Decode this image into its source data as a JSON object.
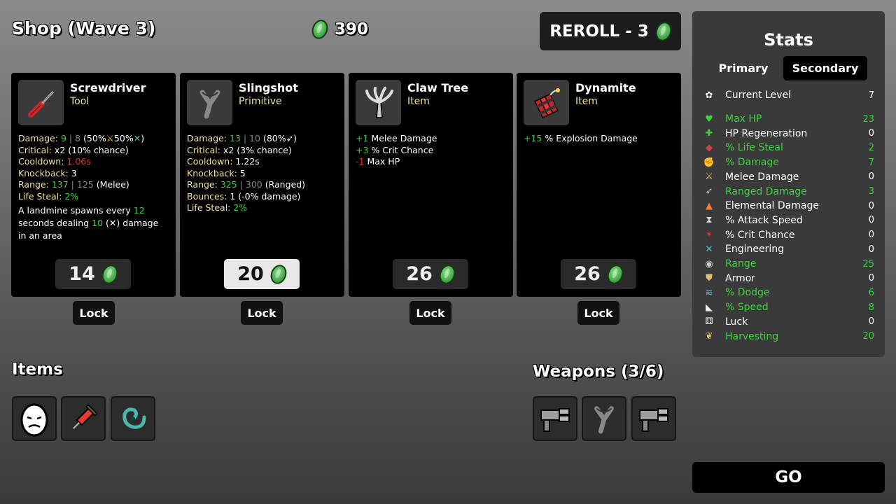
{
  "header": {
    "title": "Shop (Wave 3)",
    "gold": "390",
    "reroll_label": "REROLL - 3"
  },
  "cards": [
    {
      "name": "Screwdriver",
      "type": "Tool",
      "icon": "screwdriver-icon",
      "stats": {
        "damage_label": "Damage:",
        "damage_val": "9",
        "damage_sep": "|",
        "damage_base": "8",
        "damage_suffix": "(50%",
        "damage_suffix2": "50%",
        "damage_end": ")",
        "critical_label": "Critical:",
        "critical_val": "x2 (10% chance)",
        "cooldown_label": "Cooldown:",
        "cooldown_val": "1.06s",
        "knockback_label": "Knockback:",
        "knockback_val": "3",
        "range_label": "Range:",
        "range_val": "137",
        "range_sep": "|",
        "range_base": "125",
        "range_suffix": "(Melee)",
        "lifesteal_label": "Life Steal:",
        "lifesteal_val": "2%",
        "desc_1": "A landmine spawns every",
        "desc_1_val": "12",
        "desc_2": "seconds dealing",
        "desc_2_val": "10",
        "desc_2_paren_open": "(",
        "desc_2_end": ") damage",
        "desc_3": "in an area"
      },
      "price": "14",
      "selected": false
    },
    {
      "name": "Slingshot",
      "type": "Primitive",
      "icon": "slingshot-icon",
      "stats": {
        "damage_label": "Damage:",
        "damage_val": "13",
        "damage_sep": "|",
        "damage_base": "10",
        "damage_suffix": "(80%",
        "damage_end": ")",
        "critical_label": "Critical:",
        "critical_val": "x2 (3% chance)",
        "cooldown_label": "Cooldown:",
        "cooldown_val": "1.22s",
        "knockback_label": "Knockback:",
        "knockback_val": "5",
        "range_label": "Range:",
        "range_val": "325",
        "range_sep": "|",
        "range_base": "300",
        "range_suffix": "(Ranged)",
        "bounces_label": "Bounces:",
        "bounces_val": "1 (-0% damage)",
        "lifesteal_label": "Life Steal:",
        "lifesteal_val": "2%"
      },
      "price": "20",
      "selected": true
    },
    {
      "name": "Claw Tree",
      "type": "Item",
      "icon": "claw-tree-icon",
      "effects": [
        {
          "val": "+1",
          "text": "Melee Damage",
          "color": "#3cd23c"
        },
        {
          "val": "+3",
          "text": "% Crit Chance",
          "color": "#3cd23c"
        },
        {
          "val": "-1",
          "text": "Max HP",
          "color": "#e03030"
        }
      ],
      "price": "26",
      "selected": false
    },
    {
      "name": "Dynamite",
      "type": "Item",
      "icon": "dynamite-icon",
      "effects": [
        {
          "val": "+15",
          "text": "% Explosion Damage",
          "color": "#3cd23c"
        }
      ],
      "price": "26",
      "selected": false
    }
  ],
  "lock_label": "Lock",
  "bottom": {
    "items_title": "Items",
    "items": [
      "egg-icon",
      "syringe-icon",
      "spiral-icon"
    ],
    "weapons_title": "Weapons (3/6)",
    "weapons": [
      "minigun-icon",
      "slingshot-icon",
      "minigun-icon"
    ]
  },
  "stats_panel": {
    "title": "Stats",
    "tab_primary": "Primary",
    "tab_secondary": "Secondary",
    "active_tab": "Secondary",
    "current_level_label": "Current Level",
    "current_level_value": "7",
    "rows": [
      {
        "label": "Max HP",
        "value": "23",
        "highlight": true,
        "icon": "heart-icon",
        "glyph": "♥",
        "icolor": "#3cd23c"
      },
      {
        "label": "HP Regeneration",
        "value": "0",
        "highlight": false,
        "icon": "regen-icon",
        "glyph": "✚",
        "icolor": "#3cd23c"
      },
      {
        "label": "% Life Steal",
        "value": "2",
        "highlight": true,
        "icon": "lifesteal-icon",
        "glyph": "◆",
        "icolor": "#d04040"
      },
      {
        "label": "% Damage",
        "value": "7",
        "highlight": true,
        "icon": "damage-icon",
        "glyph": "✊",
        "icolor": "#e06050"
      },
      {
        "label": "Melee Damage",
        "value": "0",
        "highlight": false,
        "icon": "sword-icon",
        "glyph": "⚔",
        "icolor": "#e0c070"
      },
      {
        "label": "Ranged Damage",
        "value": "3",
        "highlight": true,
        "icon": "bow-icon",
        "glyph": "➶",
        "icolor": "#ccc"
      },
      {
        "label": "Elemental Damage",
        "value": "0",
        "highlight": false,
        "icon": "flame-icon",
        "glyph": "▲",
        "icolor": "#f08030"
      },
      {
        "label": "% Attack Speed",
        "value": "0",
        "highlight": false,
        "icon": "hourglass-icon",
        "glyph": "⧗",
        "icolor": "#ddd"
      },
      {
        "label": "% Crit Chance",
        "value": "0",
        "highlight": false,
        "icon": "crit-icon",
        "glyph": "✶",
        "icolor": "#e03030"
      },
      {
        "label": "Engineering",
        "value": "0",
        "highlight": false,
        "icon": "wrench-icon",
        "glyph": "✕",
        "icolor": "#60c0c0"
      },
      {
        "label": "Range",
        "value": "25",
        "highlight": true,
        "icon": "range-icon",
        "glyph": "◉",
        "icolor": "#ccc"
      },
      {
        "label": "Armor",
        "value": "0",
        "highlight": false,
        "icon": "shield-icon",
        "glyph": "⛊",
        "icolor": "#e0c070"
      },
      {
        "label": "% Dodge",
        "value": "6",
        "highlight": true,
        "icon": "dodge-icon",
        "glyph": "≋",
        "icolor": "#60c0c0"
      },
      {
        "label": "% Speed",
        "value": "8",
        "highlight": true,
        "icon": "boot-icon",
        "glyph": "◣",
        "icolor": "#eee"
      },
      {
        "label": "Luck",
        "value": "0",
        "highlight": false,
        "icon": "dice-icon",
        "glyph": "⚅",
        "icolor": "#eee"
      },
      {
        "label": "Harvesting",
        "value": "20",
        "highlight": true,
        "icon": "wheat-icon",
        "glyph": "❦",
        "icolor": "#e0c070"
      }
    ]
  },
  "go_label": "GO",
  "colors": {
    "green": "#3cd23c",
    "red": "#e03030",
    "label": "#f0e2a0"
  }
}
